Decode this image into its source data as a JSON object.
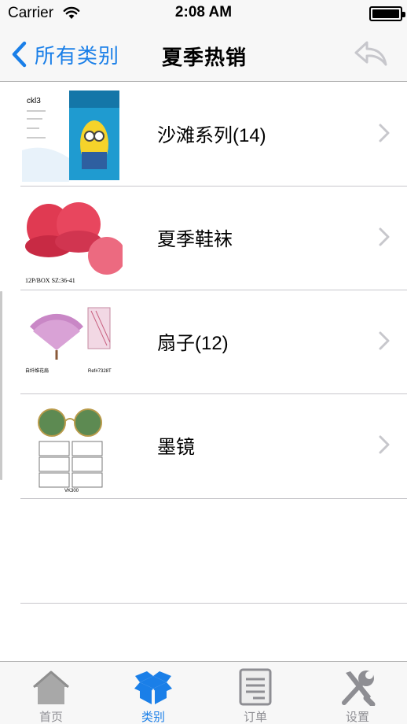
{
  "status_bar": {
    "carrier": "Carrier",
    "time": "2:08 AM"
  },
  "nav": {
    "back_label": "所有类别",
    "title": "夏季热销",
    "reply_icon": "reply-arrow-icon"
  },
  "rows": [
    {
      "label": "沙滩系列(14)",
      "thumb_icon": "towel-product-thumb"
    },
    {
      "label": "夏季鞋袜",
      "thumb_icon": "slippers-product-thumb"
    },
    {
      "label": "扇子(12)",
      "thumb_icon": "fan-product-thumb"
    },
    {
      "label": "墨镜",
      "thumb_icon": "sunglasses-product-thumb"
    }
  ],
  "tabs": [
    {
      "label": "首页",
      "icon": "home-icon",
      "active": false
    },
    {
      "label": "类别",
      "icon": "box-icon",
      "active": true
    },
    {
      "label": "订单",
      "icon": "document-icon",
      "active": false
    },
    {
      "label": "设置",
      "icon": "tools-icon",
      "active": false
    }
  ],
  "colors": {
    "accent": "#1a7fe8",
    "inactive": "#8e8e93",
    "bar_bg": "#f7f7f7",
    "separator": "#c8c7cc"
  }
}
